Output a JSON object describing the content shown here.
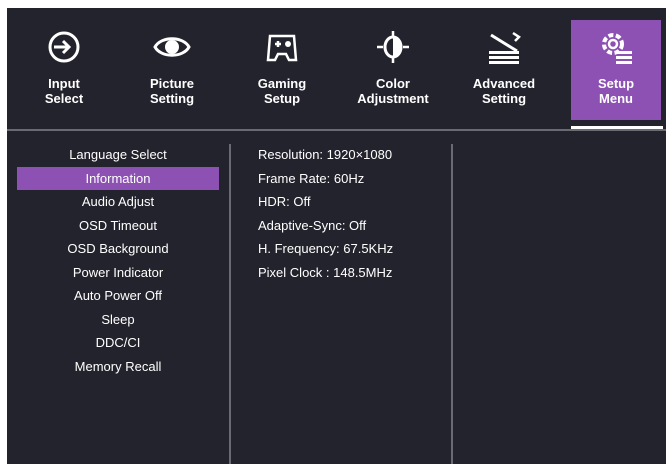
{
  "tabs": [
    {
      "label": "Input\nSelect",
      "icon": "input-icon",
      "active": false
    },
    {
      "label": "Picture\nSetting",
      "icon": "eye-icon",
      "active": false
    },
    {
      "label": "Gaming\nSetup",
      "icon": "gamepad-icon",
      "active": false
    },
    {
      "label": "Color\nAdjustment",
      "icon": "color-adjust-icon",
      "active": false
    },
    {
      "label": "Advanced\nSetting",
      "icon": "advanced-icon",
      "active": false
    },
    {
      "label": "Setup\nMenu",
      "icon": "gear-list-icon",
      "active": true
    }
  ],
  "menu": {
    "items": [
      "Language Select",
      "Information",
      "Audio Adjust",
      "OSD Timeout",
      "OSD Background",
      "Power Indicator",
      "Auto Power Off",
      "Sleep",
      "DDC/CI",
      "Memory Recall"
    ],
    "selected_index": 1
  },
  "info": {
    "rows": [
      "Resolution: 1920×1080",
      "Frame Rate: 60Hz",
      "HDR: Off",
      "Adaptive-Sync: Off",
      "H. Frequency: 67.5KHz",
      "Pixel Clock : 148.5MHz"
    ]
  },
  "colors": {
    "background": "#23232d",
    "accent": "#8c51b3",
    "text": "#ffffff",
    "divider": "#6a6a72"
  }
}
